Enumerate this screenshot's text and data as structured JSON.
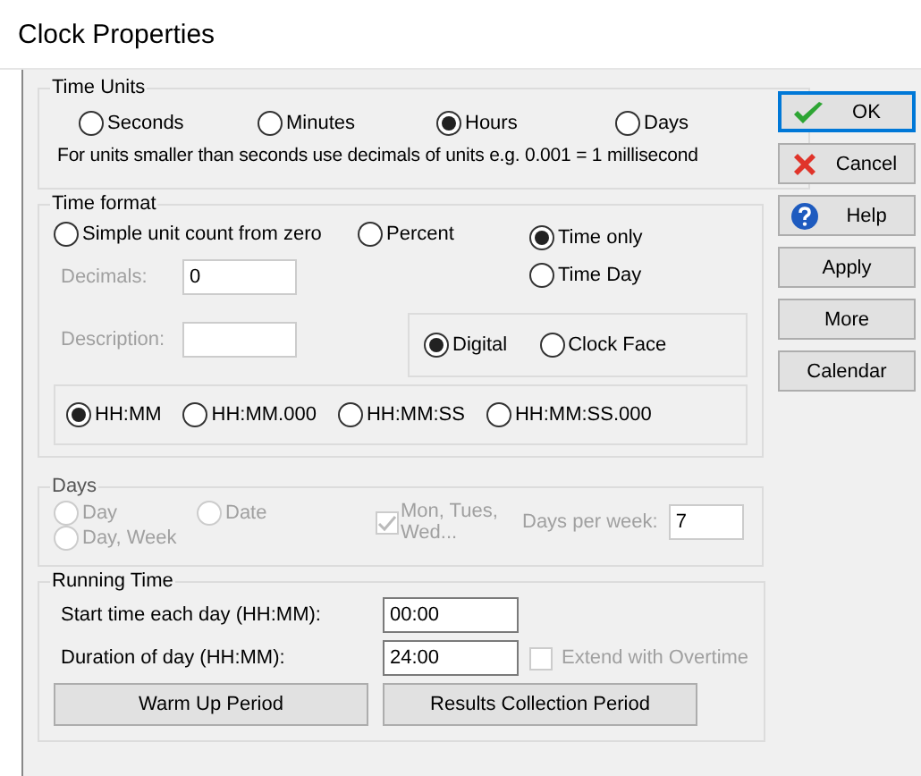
{
  "window": {
    "title": "Clock Properties"
  },
  "time_units": {
    "legend": "Time Units",
    "options": [
      {
        "label": "Seconds",
        "selected": false
      },
      {
        "label": "Minutes",
        "selected": false
      },
      {
        "label": "Hours",
        "selected": true
      },
      {
        "label": "Days",
        "selected": false
      }
    ],
    "note": "For units smaller than seconds use decimals of units e.g. 0.001 = 1 millisecond"
  },
  "time_format": {
    "legend": "Time format",
    "modes": [
      {
        "label": "Simple unit count from zero",
        "selected": false
      },
      {
        "label": "Percent",
        "selected": false
      },
      {
        "label": "Time only",
        "selected": true
      },
      {
        "label": "Time  Day",
        "selected": false
      }
    ],
    "decimals": {
      "label": "Decimals:",
      "value": "0",
      "disabled": true
    },
    "description": {
      "label": "Description:",
      "disabled": true
    },
    "display": [
      {
        "label": "Digital",
        "selected": true
      },
      {
        "label": "Clock Face",
        "selected": false
      }
    ],
    "formats": [
      {
        "label": "HH:MM",
        "selected": true
      },
      {
        "label": "HH:MM.000",
        "selected": false
      },
      {
        "label": "HH:MM:SS",
        "selected": false
      },
      {
        "label": "HH:MM:SS.000",
        "selected": false
      }
    ]
  },
  "days": {
    "legend": "Days",
    "disabled": true,
    "options": [
      {
        "label": "Day",
        "selected": false
      },
      {
        "label": "Date",
        "selected": false
      },
      {
        "label": "Day, Week",
        "selected": false
      }
    ],
    "weekdays": {
      "label": "Mon, Tues, Wed...",
      "checked": true
    },
    "days_per_week": {
      "label": "Days per week:",
      "value": "7"
    }
  },
  "running_time": {
    "legend": "Running Time",
    "start": {
      "label": "Start time each day (HH:MM):",
      "value": "00:00"
    },
    "duration": {
      "label": "Duration of day (HH:MM):",
      "value": "24:00"
    },
    "extend": {
      "label": "Extend with Overtime",
      "checked": false,
      "disabled": true
    },
    "buttons": [
      "Warm Up Period",
      "Results Collection Period"
    ]
  },
  "buttons": [
    {
      "label": "OK",
      "kind": "check",
      "default": true
    },
    {
      "label": "Cancel",
      "kind": "cross",
      "default": false
    },
    {
      "label": "Help",
      "kind": "help",
      "default": false
    },
    {
      "label": "Apply",
      "kind": "plain",
      "default": false
    },
    {
      "label": "More",
      "kind": "plain",
      "default": false
    },
    {
      "label": "Calendar",
      "kind": "plain",
      "default": false
    }
  ]
}
